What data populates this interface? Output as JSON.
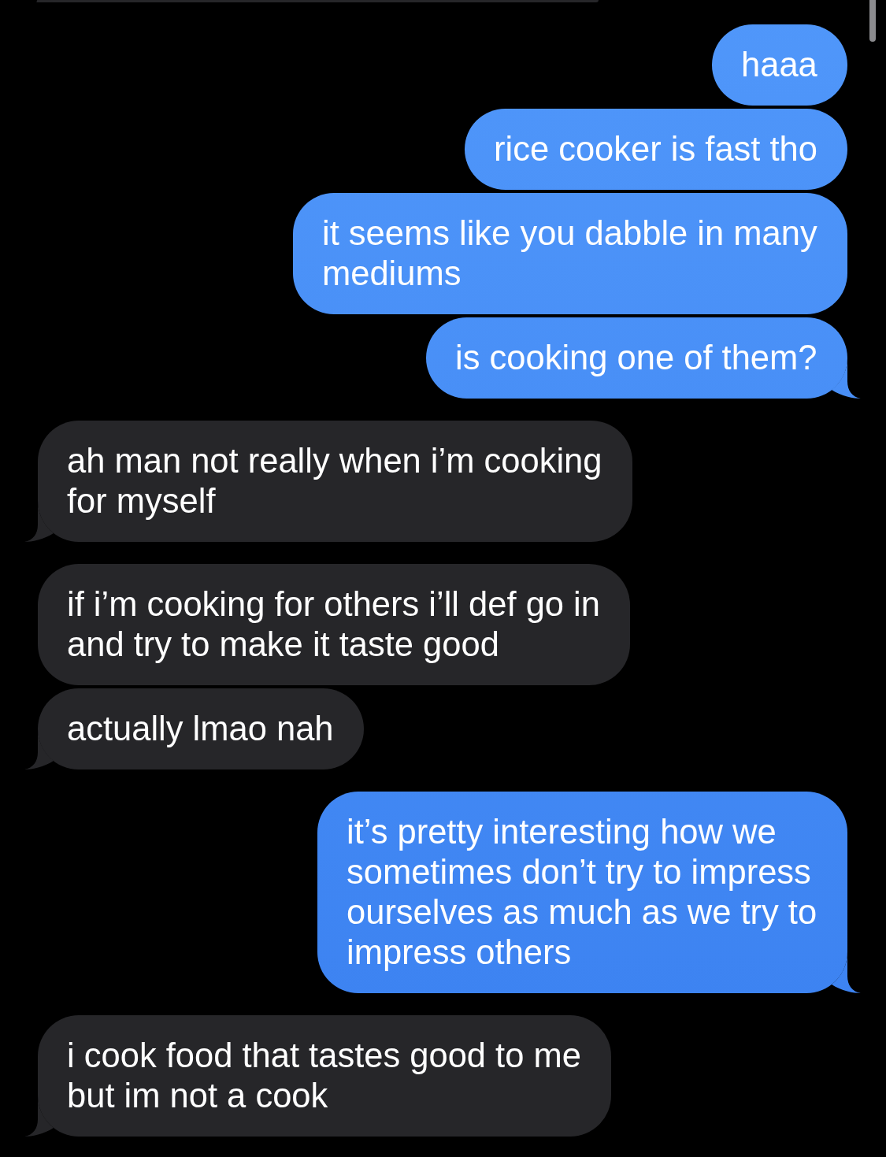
{
  "messages": [
    {
      "kind": "received",
      "clipped": true,
      "tail": true
    },
    {
      "kind": "sent",
      "clipped": false,
      "tail": false,
      "text": "haaa"
    },
    {
      "kind": "sent",
      "clipped": false,
      "tail": false,
      "text": "rice cooker is fast tho"
    },
    {
      "kind": "sent",
      "clipped": false,
      "tail": false,
      "text": "it seems like you dabble in many mediums"
    },
    {
      "kind": "sent",
      "clipped": false,
      "tail": true,
      "text": "is cooking one of them?"
    },
    {
      "kind": "received",
      "clipped": false,
      "tail": true,
      "text": "ah man not really when i’m cooking for myself"
    },
    {
      "kind": "received",
      "clipped": false,
      "tail": false,
      "text": "if i’m cooking for others i’ll def go in and try to make it taste good"
    },
    {
      "kind": "received",
      "clipped": false,
      "tail": true,
      "text": "actually lmao nah"
    },
    {
      "kind": "sent",
      "clipped": false,
      "tail": true,
      "text": "it’s pretty interesting how we sometimes don’t try to impress ourselves as much as we try to impress others"
    },
    {
      "kind": "received",
      "clipped": false,
      "tail": true,
      "text": "i cook food that tastes good to me but im not a cook"
    }
  ]
}
